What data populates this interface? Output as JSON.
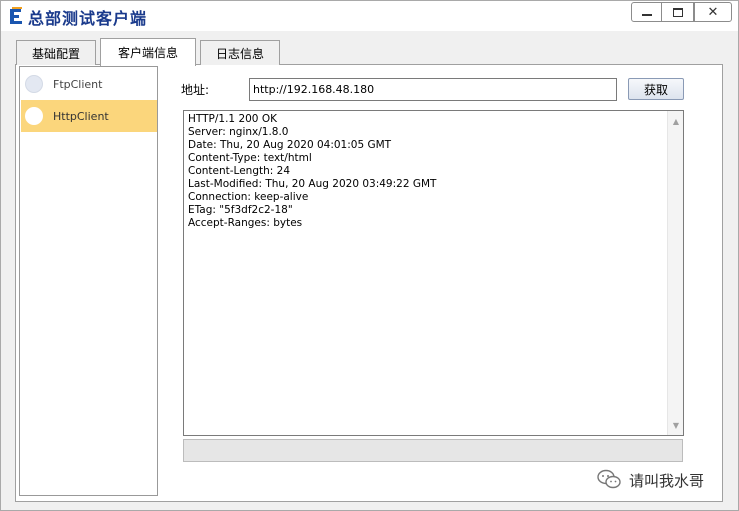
{
  "window": {
    "title": "总部测试客户端",
    "buttons": {
      "minimize": "minimize-icon",
      "maximize": "maximize-icon",
      "close": "✕"
    }
  },
  "tabs": [
    {
      "label": "基础配置",
      "active": false
    },
    {
      "label": "客户端信息",
      "active": true
    },
    {
      "label": "日志信息",
      "active": false
    }
  ],
  "sidebar": {
    "items": [
      {
        "label": "FtpClient",
        "selected": false
      },
      {
        "label": "HttpClient",
        "selected": true
      }
    ],
    "selected_color": "#fbd67c"
  },
  "address": {
    "label": "地址:",
    "value": "http://192.168.48.180",
    "fetch_label": "获取"
  },
  "response": {
    "lines": [
      "HTTP/1.1 200 OK",
      "Server: nginx/1.8.0",
      "Date: Thu, 20 Aug 2020 04:01:05 GMT",
      "Content-Type: text/html",
      "Content-Length: 24",
      "Last-Modified: Thu, 20 Aug 2020 03:49:22 GMT",
      "Connection: keep-alive",
      "ETag: \"5f3df2c2-18\"",
      "Accept-Ranges: bytes"
    ]
  },
  "progress": {
    "value": 0
  },
  "watermark": {
    "text": "请叫我水哥",
    "icon": "wechat-icon"
  }
}
